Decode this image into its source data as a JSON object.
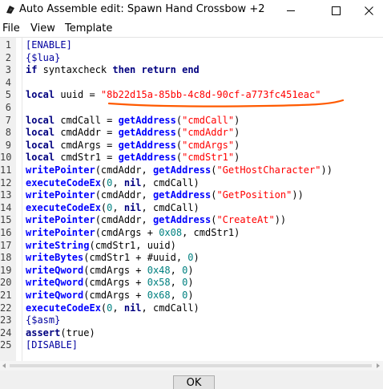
{
  "window": {
    "title": "Auto Assemble edit: Spawn Hand Crossbow +2"
  },
  "menu": {
    "file": "File",
    "view": "View",
    "template": "Template"
  },
  "colors": {
    "keyword": "#000080",
    "function": "#0000ff",
    "string": "#ff0000",
    "number": "#008080",
    "annotation_underline": "#ff5a00"
  },
  "editor": {
    "line_numbers": [
      "1",
      "2",
      "3",
      "4",
      "5",
      "6",
      "7",
      "8",
      "9",
      "10",
      "11",
      "12",
      "13",
      "14",
      "15",
      "16",
      "17",
      "18",
      "19",
      "20",
      "21",
      "22",
      "23",
      "24",
      "25"
    ],
    "lines": [
      [
        {
          "t": "dir",
          "v": "[ENABLE]"
        }
      ],
      [
        {
          "t": "dir",
          "v": "{$lua}"
        }
      ],
      [
        {
          "t": "kw",
          "v": "if"
        },
        {
          "t": "plain",
          "v": " syntaxcheck "
        },
        {
          "t": "kw",
          "v": "then"
        },
        {
          "t": "plain",
          "v": " "
        },
        {
          "t": "kw",
          "v": "return"
        },
        {
          "t": "plain",
          "v": " "
        },
        {
          "t": "kw",
          "v": "end"
        }
      ],
      [],
      [
        {
          "t": "kw",
          "v": "local"
        },
        {
          "t": "plain",
          "v": " uuid = "
        },
        {
          "t": "str",
          "v": "\"8b22d15a-85bb-4c8d-90cf-a773fc451eac\""
        }
      ],
      [],
      [
        {
          "t": "kw",
          "v": "local"
        },
        {
          "t": "plain",
          "v": " cmdCall = "
        },
        {
          "t": "fn",
          "v": "getAddress"
        },
        {
          "t": "plain",
          "v": "("
        },
        {
          "t": "str",
          "v": "\"cmdCall\""
        },
        {
          "t": "plain",
          "v": ")"
        }
      ],
      [
        {
          "t": "kw",
          "v": "local"
        },
        {
          "t": "plain",
          "v": " cmdAddr = "
        },
        {
          "t": "fn",
          "v": "getAddress"
        },
        {
          "t": "plain",
          "v": "("
        },
        {
          "t": "str",
          "v": "\"cmdAddr\""
        },
        {
          "t": "plain",
          "v": ")"
        }
      ],
      [
        {
          "t": "kw",
          "v": "local"
        },
        {
          "t": "plain",
          "v": " cmdArgs = "
        },
        {
          "t": "fn",
          "v": "getAddress"
        },
        {
          "t": "plain",
          "v": "("
        },
        {
          "t": "str",
          "v": "\"cmdArgs\""
        },
        {
          "t": "plain",
          "v": ")"
        }
      ],
      [
        {
          "t": "kw",
          "v": "local"
        },
        {
          "t": "plain",
          "v": " cmdStr1 = "
        },
        {
          "t": "fn",
          "v": "getAddress"
        },
        {
          "t": "plain",
          "v": "("
        },
        {
          "t": "str",
          "v": "\"cmdStr1\""
        },
        {
          "t": "plain",
          "v": ")"
        }
      ],
      [
        {
          "t": "fn",
          "v": "writePointer"
        },
        {
          "t": "plain",
          "v": "(cmdAddr, "
        },
        {
          "t": "fn",
          "v": "getAddress"
        },
        {
          "t": "plain",
          "v": "("
        },
        {
          "t": "str",
          "v": "\"GetHostCharacter\""
        },
        {
          "t": "plain",
          "v": "))"
        }
      ],
      [
        {
          "t": "fn",
          "v": "executeCodeEx"
        },
        {
          "t": "plain",
          "v": "("
        },
        {
          "t": "num",
          "v": "0"
        },
        {
          "t": "plain",
          "v": ", "
        },
        {
          "t": "kw",
          "v": "nil"
        },
        {
          "t": "plain",
          "v": ", cmdCall)"
        }
      ],
      [
        {
          "t": "fn",
          "v": "writePointer"
        },
        {
          "t": "plain",
          "v": "(cmdAddr, "
        },
        {
          "t": "fn",
          "v": "getAddress"
        },
        {
          "t": "plain",
          "v": "("
        },
        {
          "t": "str",
          "v": "\"GetPosition\""
        },
        {
          "t": "plain",
          "v": "))"
        }
      ],
      [
        {
          "t": "fn",
          "v": "executeCodeEx"
        },
        {
          "t": "plain",
          "v": "("
        },
        {
          "t": "num",
          "v": "0"
        },
        {
          "t": "plain",
          "v": ", "
        },
        {
          "t": "kw",
          "v": "nil"
        },
        {
          "t": "plain",
          "v": ", cmdCall)"
        }
      ],
      [
        {
          "t": "fn",
          "v": "writePointer"
        },
        {
          "t": "plain",
          "v": "(cmdAddr, "
        },
        {
          "t": "fn",
          "v": "getAddress"
        },
        {
          "t": "plain",
          "v": "("
        },
        {
          "t": "str",
          "v": "\"CreateAt\""
        },
        {
          "t": "plain",
          "v": "))"
        }
      ],
      [
        {
          "t": "fn",
          "v": "writePointer"
        },
        {
          "t": "plain",
          "v": "(cmdArgs + "
        },
        {
          "t": "num",
          "v": "0x08"
        },
        {
          "t": "plain",
          "v": ", cmdStr1)"
        }
      ],
      [
        {
          "t": "fn",
          "v": "writeString"
        },
        {
          "t": "plain",
          "v": "(cmdStr1, uuid)"
        }
      ],
      [
        {
          "t": "fn",
          "v": "writeBytes"
        },
        {
          "t": "plain",
          "v": "(cmdStr1 + #uuid, "
        },
        {
          "t": "num",
          "v": "0"
        },
        {
          "t": "plain",
          "v": ")"
        }
      ],
      [
        {
          "t": "fn",
          "v": "writeQword"
        },
        {
          "t": "plain",
          "v": "(cmdArgs + "
        },
        {
          "t": "num",
          "v": "0x48"
        },
        {
          "t": "plain",
          "v": ", "
        },
        {
          "t": "num",
          "v": "0"
        },
        {
          "t": "plain",
          "v": ")"
        }
      ],
      [
        {
          "t": "fn",
          "v": "writeQword"
        },
        {
          "t": "plain",
          "v": "(cmdArgs + "
        },
        {
          "t": "num",
          "v": "0x58"
        },
        {
          "t": "plain",
          "v": ", "
        },
        {
          "t": "num",
          "v": "0"
        },
        {
          "t": "plain",
          "v": ")"
        }
      ],
      [
        {
          "t": "fn",
          "v": "writeQword"
        },
        {
          "t": "plain",
          "v": "(cmdArgs + "
        },
        {
          "t": "num",
          "v": "0x68"
        },
        {
          "t": "plain",
          "v": ", "
        },
        {
          "t": "num",
          "v": "0"
        },
        {
          "t": "plain",
          "v": ")"
        }
      ],
      [
        {
          "t": "fn",
          "v": "executeCodeEx"
        },
        {
          "t": "plain",
          "v": "("
        },
        {
          "t": "num",
          "v": "0"
        },
        {
          "t": "plain",
          "v": ", "
        },
        {
          "t": "kw",
          "v": "nil"
        },
        {
          "t": "plain",
          "v": ", cmdCall)"
        }
      ],
      [
        {
          "t": "dir",
          "v": "{$asm}"
        }
      ],
      [
        {
          "t": "kw",
          "v": "assert"
        },
        {
          "t": "plain",
          "v": "(true)"
        }
      ],
      [
        {
          "t": "dir",
          "v": "[DISABLE]"
        }
      ]
    ]
  },
  "footer": {
    "ok_label": "OK"
  }
}
